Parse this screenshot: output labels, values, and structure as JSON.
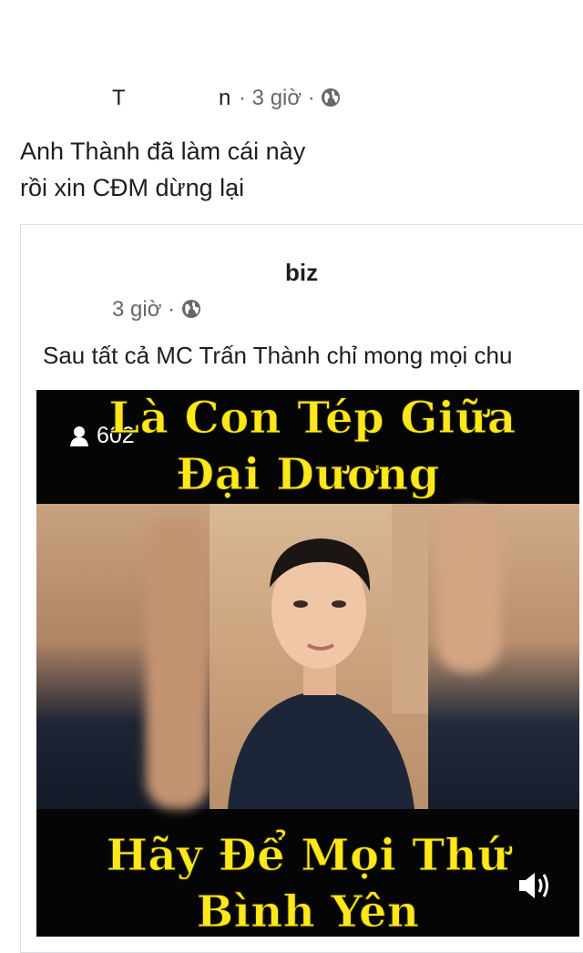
{
  "post": {
    "author_first": "T",
    "author_last": "n",
    "time": "3 giờ",
    "separator": "·",
    "text_line1": "Anh Thành đã làm cái này",
    "text_line2": "rồi xin CĐM dừng lại"
  },
  "shared": {
    "page_name": "biz",
    "time": "3 giờ",
    "separator": "·",
    "caption": "Sau tất cả MC Trấn Thành chỉ mong mọi chu"
  },
  "video": {
    "viewers": "602",
    "title_line1": "Là Con Tép Giữa",
    "title_line2": "Đại Dương",
    "bottom_line1": "Hãy Để Mọi Thứ",
    "bottom_line2": "Bình Yên"
  },
  "icons": {
    "globe": "globe-icon",
    "viewer": "person-icon",
    "sound": "speaker-icon"
  },
  "colors": {
    "caption_yellow": "#ffe81a",
    "meta_gray": "#65676b",
    "text": "#1c1e21"
  }
}
